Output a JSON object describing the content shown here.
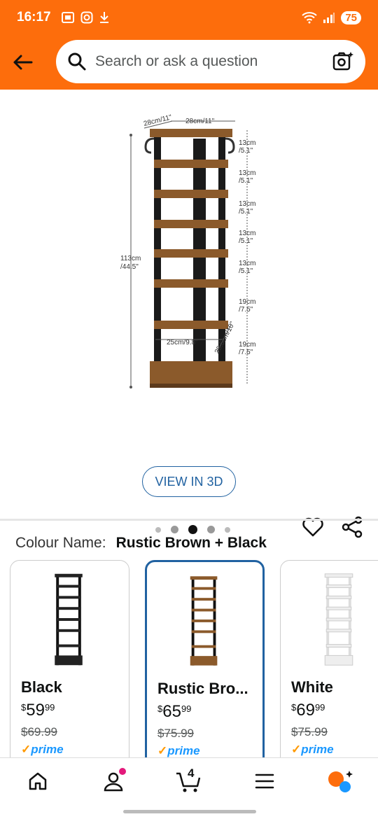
{
  "status_bar": {
    "time": "16:17",
    "battery": "75"
  },
  "search": {
    "placeholder": "Search or ask a question"
  },
  "product_image": {
    "dimensions": {
      "depth_top": "28cm/11\"",
      "width_top": "28cm/11\"",
      "height_total_cm": "113cm",
      "height_total_in": "/44.5\"",
      "shelf_gaps": [
        {
          "cm": "13cm",
          "in": "/5.1\""
        },
        {
          "cm": "13cm",
          "in": "/5.1\""
        },
        {
          "cm": "13cm",
          "in": "/5.1\""
        },
        {
          "cm": "13cm",
          "in": "/5.1\""
        },
        {
          "cm": "13cm",
          "in": "/5.1\""
        },
        {
          "cm": "19cm",
          "in": "/7.5\""
        },
        {
          "cm": "19cm",
          "in": "/7.5\""
        }
      ],
      "bottom_width": "25cm/9.8\"",
      "bottom_depth": "25.5cm/10\""
    },
    "carousel_total": 5,
    "carousel_active": 2
  },
  "view3d_label": "VIEW IN 3D",
  "colour": {
    "label": "Colour Name:",
    "selected": "Rustic Brown + Black",
    "options": [
      {
        "name": "Black",
        "currency": "$",
        "whole": "59",
        "fraction": "99",
        "was": "$69.99",
        "prime": "prime",
        "color": "#222222"
      },
      {
        "name": "Rustic Bro...",
        "currency": "$",
        "whole": "65",
        "fraction": "99",
        "was": "$75.99",
        "prime": "prime",
        "color": "#8b5a2b"
      },
      {
        "name": "White",
        "currency": "$",
        "whole": "69",
        "fraction": "99",
        "was": "$75.99",
        "prime": "prime",
        "color": "#ffffff"
      }
    ]
  },
  "bottom_nav": {
    "cart_count": "4"
  },
  "colors": {
    "brand_orange": "#fd6d0c",
    "link_blue": "#2162a1",
    "prime_blue": "#1a98ff"
  }
}
